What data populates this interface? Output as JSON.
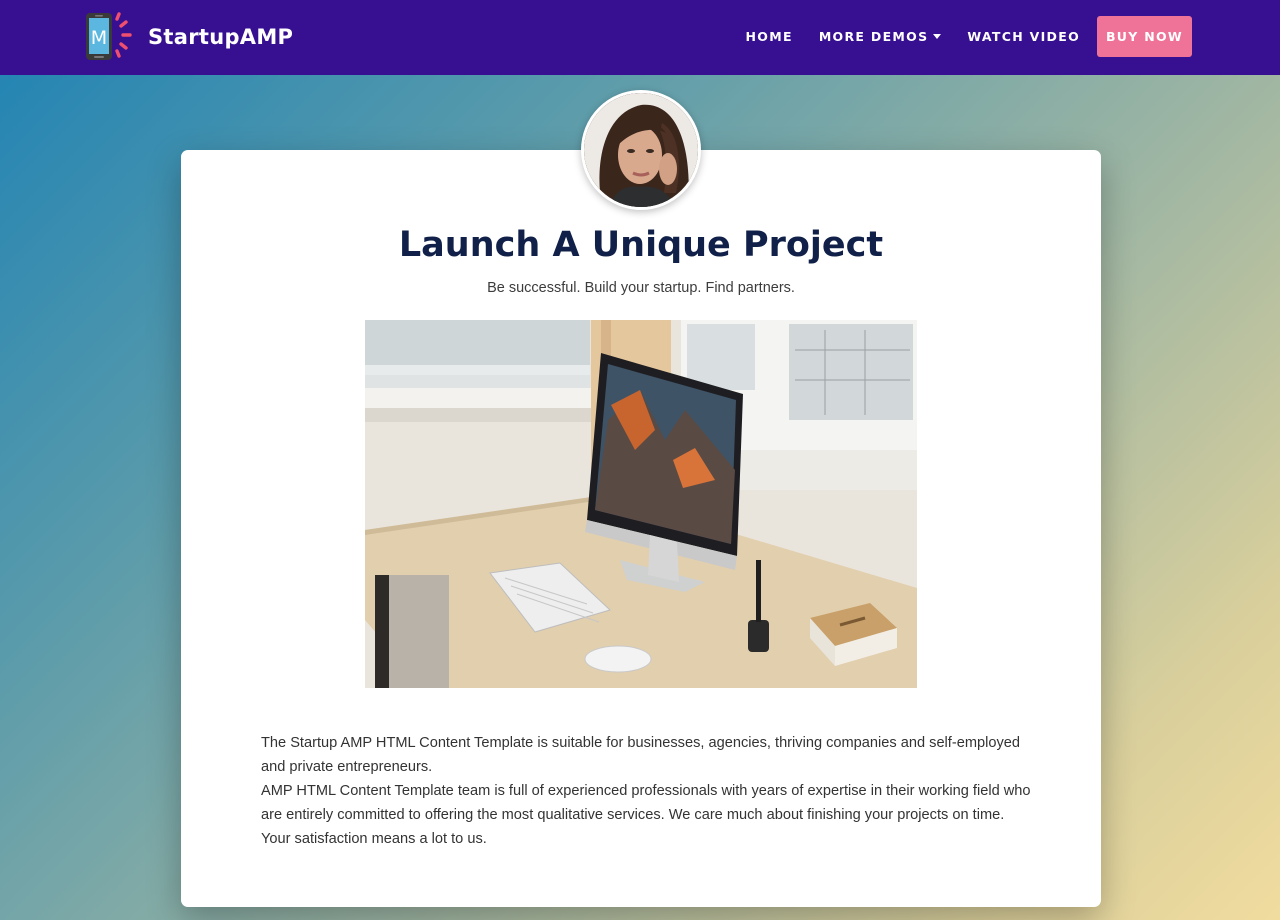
{
  "brand": {
    "logo_letter": "M",
    "name": "StartupAMP"
  },
  "nav": {
    "items": [
      {
        "label": "HOME",
        "has_dropdown": false
      },
      {
        "label": "MORE DEMOS",
        "has_dropdown": true
      },
      {
        "label": "WATCH VIDEO",
        "has_dropdown": false
      }
    ],
    "cta": "BUY NOW"
  },
  "card": {
    "title": "Launch A Unique Project",
    "subtitle": "Be successful. Build your startup. Find partners.",
    "paragraphs": [
      "The Startup AMP HTML Content Template is suitable for businesses, agencies, thriving companies and self-employed and private entrepreneurs.",
      "AMP HTML Content Template team is full of experienced professionals with years of expertise in their working field who are entirely committed to offering the most qualitative services. We care much about finishing your projects on time. Your satisfaction means a lot to us."
    ]
  },
  "icons": {
    "logo": "phone-sunburst-logo",
    "dropdown": "chevron-down-icon"
  },
  "colors": {
    "navbar": "#371091",
    "cta": "#ef7398",
    "title": "#102048"
  }
}
